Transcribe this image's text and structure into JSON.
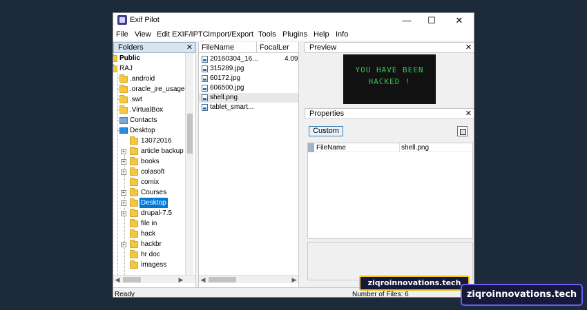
{
  "window": {
    "title": "Exif Pilot",
    "minimize_glyph": "—",
    "maximize_glyph": "☐",
    "close_glyph": "✕"
  },
  "menu": [
    "File",
    "View",
    "Edit EXIF/IPTC",
    "Import/Export",
    "Tools",
    "Plugins",
    "Help",
    "Info"
  ],
  "folders": {
    "header": "Folders",
    "close_glyph": "✕",
    "items": [
      {
        "label": "Public",
        "icon": "folder-icon",
        "bold": true
      },
      {
        "label": "RAJ",
        "icon": "folder-icon"
      },
      {
        "label": ".android",
        "icon": "folder-icon"
      },
      {
        "label": ".oracle_jre_usage",
        "icon": "folder-icon"
      },
      {
        "label": ".swt",
        "icon": "folder-icon"
      },
      {
        "label": ".VirtualBox",
        "icon": "folder-icon"
      },
      {
        "label": "Contacts",
        "icon": "contacts-icon"
      },
      {
        "label": "Desktop",
        "icon": "desktop-icon"
      },
      {
        "label": "13072016",
        "icon": "folder-icon"
      },
      {
        "label": "article backup",
        "icon": "folder-icon"
      },
      {
        "label": "books",
        "icon": "folder-icon"
      },
      {
        "label": "colasoft",
        "icon": "folder-icon"
      },
      {
        "label": "comix",
        "icon": "folder-icon"
      },
      {
        "label": "Courses",
        "icon": "folder-icon"
      },
      {
        "label": "Desktop",
        "icon": "folder-icon",
        "selected": true
      },
      {
        "label": "drupal-7.5",
        "icon": "folder-icon"
      },
      {
        "label": "file in",
        "icon": "folder-icon"
      },
      {
        "label": "hack",
        "icon": "folder-icon"
      },
      {
        "label": "hackbr",
        "icon": "folder-icon"
      },
      {
        "label": "hr doc",
        "icon": "folder-icon"
      },
      {
        "label": "imagess",
        "icon": "folder-icon"
      }
    ]
  },
  "files": {
    "columns": [
      "FileName",
      "FocalLer"
    ],
    "rows": [
      {
        "name": "20160304_16...",
        "focal": "4.09"
      },
      {
        "name": "315289.jpg",
        "focal": ""
      },
      {
        "name": "60172.jpg",
        "focal": ""
      },
      {
        "name": "606500.jpg",
        "focal": ""
      },
      {
        "name": "shell.png",
        "focal": "",
        "highlight": true
      },
      {
        "name": "tablet_smart...",
        "focal": ""
      }
    ]
  },
  "preview": {
    "header": "Preview",
    "close_glyph": "✕",
    "image_text": "YOU HAVE BEEN\nHACKED !"
  },
  "properties": {
    "header": "Properties",
    "close_glyph": "✕",
    "custom_label": "Custom",
    "rows": [
      {
        "key": "FileName",
        "value": "shell.png"
      }
    ]
  },
  "status": {
    "left": "Ready",
    "right": "Number of Files: 6"
  },
  "watermarks": {
    "inner": "ziqroinnovations.tech",
    "main": "ziqroinnovations.tech"
  },
  "colors": {
    "selection": "#0078d7",
    "hacked_text": "#37c35a",
    "watermark_bg": "#151a3d",
    "watermark_border_main": "#6c5ef5",
    "watermark_border_inner": "#f2c21b"
  }
}
